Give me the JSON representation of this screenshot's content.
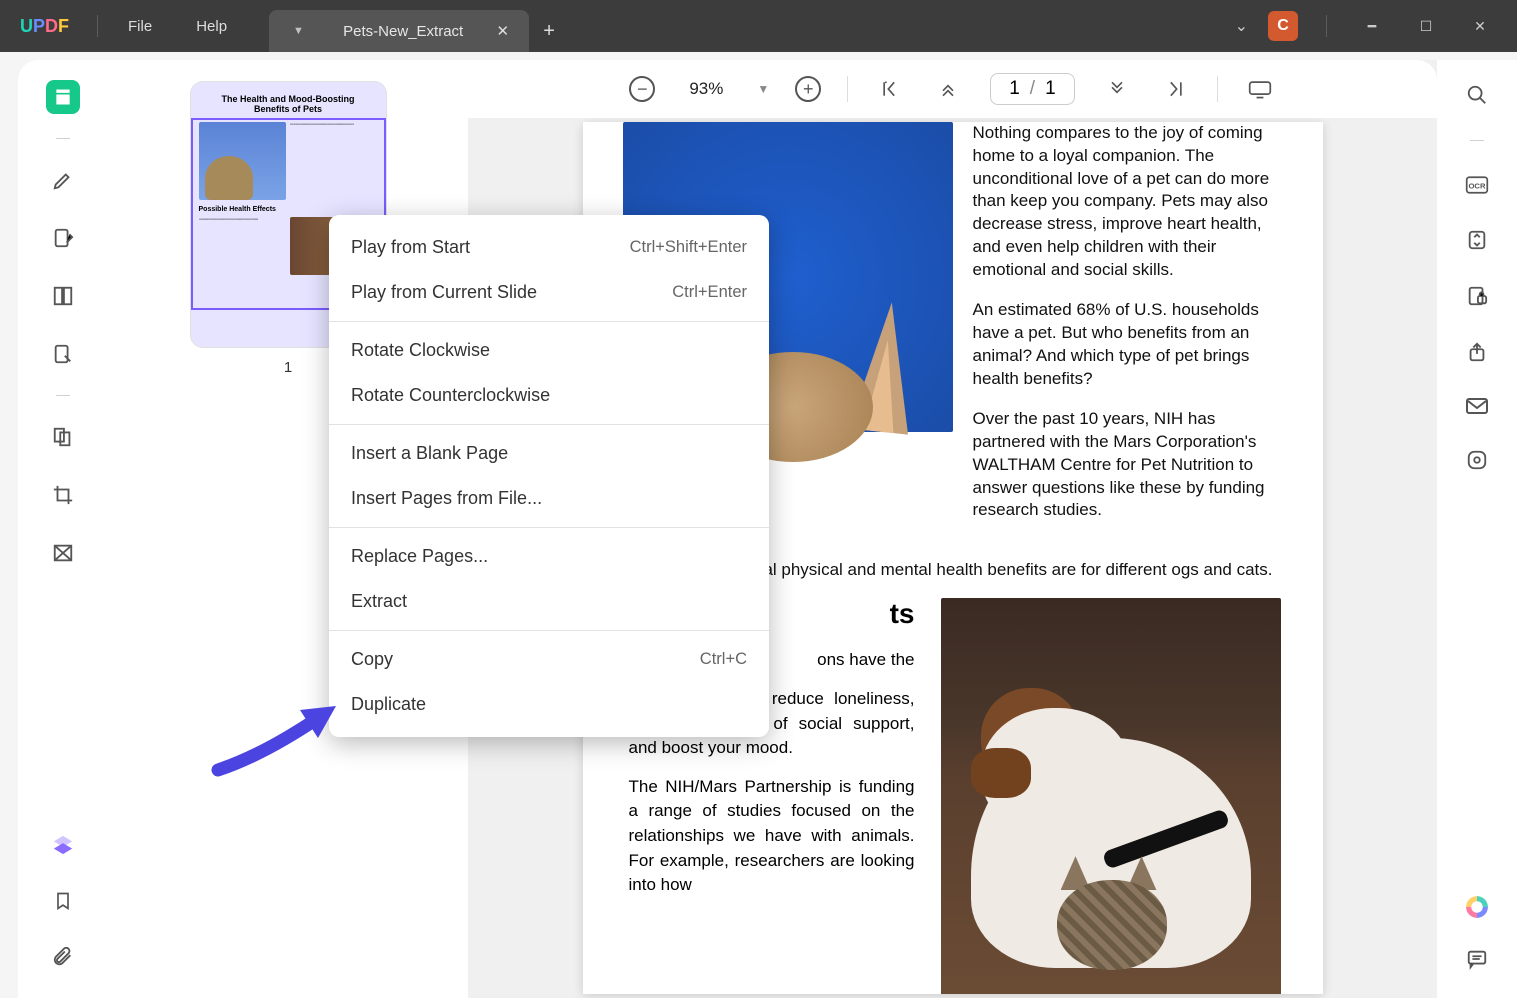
{
  "titlebar": {
    "logo_letters": [
      "U",
      "P",
      "D",
      "F"
    ],
    "menu_file": "File",
    "menu_help": "Help",
    "avatar_letter": "C"
  },
  "tab": {
    "title": "Pets-New_Extract"
  },
  "toolbar": {
    "zoom_value": "93%",
    "page_current": "1",
    "page_sep": "/",
    "page_total": "1"
  },
  "thumbnails": {
    "page1": {
      "title": "The Health and Mood-Boosting Benefits of Pets",
      "subhead": "Possible Health Effects",
      "number": "1"
    }
  },
  "document": {
    "p1": "Nothing compares to the joy of coming home to a loyal companion. The unconditional love of a pet can do more than keep you company. Pets may also decrease stress, improve heart health,  and  even  help children  with  their emotional and social skills.",
    "p2": "An estimated 68% of U.S. households have a pet. But who benefits from an animal? And which type of pet brings health benefits?",
    "p3": "Over  the  past  10  years,  NIH  has partnered with the Mars Corporation's WALTHAM Centre for  Pet  Nutrition  to answer  questions  like these by funding research studies.",
    "p_mid": "ntial physical and mental health benefits are for different ogs and cats.",
    "h2": "ts",
    "lp1": "ons have the",
    "lp2": "wn to lated ther reduce loneliness,  increase  feelings  of social support, and boost your mood.",
    "lp3": "The NIH/Mars Partnership is funding a range of studies focused on the   relationships we have with animals. For example, researchers are looking into how"
  },
  "context_menu": {
    "items": [
      {
        "label": "Play from Start",
        "shortcut": "Ctrl+Shift+Enter"
      },
      {
        "label": "Play from Current Slide",
        "shortcut": "Ctrl+Enter"
      },
      {
        "type": "divider"
      },
      {
        "label": "Rotate Clockwise"
      },
      {
        "label": "Rotate Counterclockwise"
      },
      {
        "type": "divider"
      },
      {
        "label": "Insert a Blank Page"
      },
      {
        "label": "Insert Pages from File..."
      },
      {
        "type": "divider"
      },
      {
        "label": "Replace Pages..."
      },
      {
        "label": "Extract"
      },
      {
        "type": "divider"
      },
      {
        "label": "Copy",
        "shortcut": "Ctrl+C"
      },
      {
        "label": "Duplicate"
      }
    ]
  },
  "left_sidebar_icons": [
    "reader",
    "highlighter",
    "edit-text",
    "page-display",
    "fill-sign",
    "organize-pages",
    "crop",
    "redact",
    "layers",
    "bookmark",
    "attachment"
  ],
  "right_sidebar_icons": [
    "search",
    "ocr",
    "convert",
    "protect",
    "share",
    "email",
    "save",
    "ai-logo",
    "comment"
  ]
}
